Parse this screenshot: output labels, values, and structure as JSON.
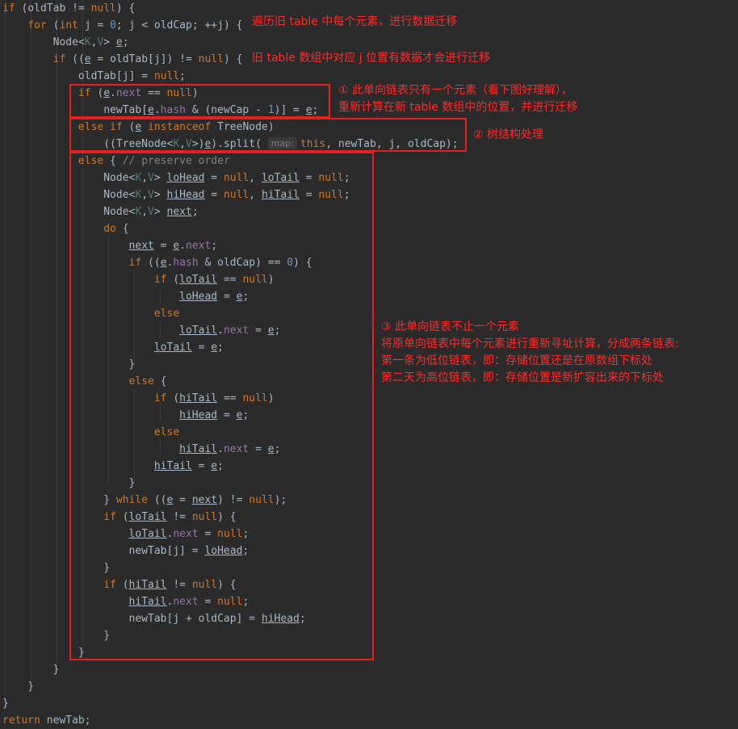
{
  "code_lines": [
    [
      {
        "t": "if",
        "c": "kw"
      },
      {
        "t": " (oldTab != "
      },
      {
        "t": "null",
        "c": "kw"
      },
      {
        "t": ") {"
      }
    ],
    [
      {
        "t": "    "
      },
      {
        "t": "for",
        "c": "kw"
      },
      {
        "t": " ("
      },
      {
        "t": "int",
        "c": "kw"
      },
      {
        "t": " j = "
      },
      {
        "t": "0",
        "c": "num"
      },
      {
        "t": "; j < oldCap; ++j) {"
      }
    ],
    [
      {
        "t": "        Node<"
      },
      {
        "t": "K",
        "c": "gen"
      },
      {
        "t": ","
      },
      {
        "t": "V",
        "c": "gen"
      },
      {
        "t": "> "
      },
      {
        "t": "e",
        "c": "ul"
      },
      {
        "t": ";"
      }
    ],
    [
      {
        "t": "        "
      },
      {
        "t": "if",
        "c": "kw"
      },
      {
        "t": " (("
      },
      {
        "t": "e",
        "c": "ul"
      },
      {
        "t": " = oldTab[j]) != "
      },
      {
        "t": "null",
        "c": "kw"
      },
      {
        "t": ") {"
      }
    ],
    [
      {
        "t": "            oldTab[j] = "
      },
      {
        "t": "null",
        "c": "kw"
      },
      {
        "t": ";"
      }
    ],
    [
      {
        "t": "            "
      },
      {
        "t": "if",
        "c": "kw"
      },
      {
        "t": " ("
      },
      {
        "t": "e",
        "c": "ul"
      },
      {
        "t": "."
      },
      {
        "t": "next",
        "c": "fld"
      },
      {
        "t": " == "
      },
      {
        "t": "null",
        "c": "kw"
      },
      {
        "t": ")"
      }
    ],
    [
      {
        "t": "                newTab["
      },
      {
        "t": "e",
        "c": "ul"
      },
      {
        "t": "."
      },
      {
        "t": "hash",
        "c": "fld"
      },
      {
        "t": " & (newCap - "
      },
      {
        "t": "1",
        "c": "num"
      },
      {
        "t": ")] = "
      },
      {
        "t": "e",
        "c": "ul"
      },
      {
        "t": ";"
      }
    ],
    [
      {
        "t": "            "
      },
      {
        "t": "else if",
        "c": "kw"
      },
      {
        "t": " ("
      },
      {
        "t": "e",
        "c": "ul"
      },
      {
        "t": " "
      },
      {
        "t": "instanceof",
        "c": "kw"
      },
      {
        "t": " TreeNode)"
      }
    ],
    [
      {
        "t": "                ((TreeNode<"
      },
      {
        "t": "K",
        "c": "gen"
      },
      {
        "t": ","
      },
      {
        "t": "V",
        "c": "gen"
      },
      {
        "t": ">)"
      },
      {
        "t": "e",
        "c": "ul"
      },
      {
        "t": ").split( "
      },
      {
        "t": "map:",
        "c": "hint"
      },
      {
        "t": "this",
        "c": "kw"
      },
      {
        "t": ", newTab, j, oldCap);"
      }
    ],
    [
      {
        "t": "            "
      },
      {
        "t": "else",
        "c": "kw"
      },
      {
        "t": " { "
      },
      {
        "t": "// preserve order",
        "c": "cmt"
      }
    ],
    [
      {
        "t": "                Node<"
      },
      {
        "t": "K",
        "c": "gen"
      },
      {
        "t": ","
      },
      {
        "t": "V",
        "c": "gen"
      },
      {
        "t": "> "
      },
      {
        "t": "loHead",
        "c": "ul"
      },
      {
        "t": " = "
      },
      {
        "t": "null",
        "c": "kw"
      },
      {
        "t": ", "
      },
      {
        "t": "loTail",
        "c": "ul"
      },
      {
        "t": " = "
      },
      {
        "t": "null",
        "c": "kw"
      },
      {
        "t": ";"
      }
    ],
    [
      {
        "t": "                Node<"
      },
      {
        "t": "K",
        "c": "gen"
      },
      {
        "t": ","
      },
      {
        "t": "V",
        "c": "gen"
      },
      {
        "t": "> "
      },
      {
        "t": "hiHead",
        "c": "ul"
      },
      {
        "t": " = "
      },
      {
        "t": "null",
        "c": "kw"
      },
      {
        "t": ", "
      },
      {
        "t": "hiTail",
        "c": "ul"
      },
      {
        "t": " = "
      },
      {
        "t": "null",
        "c": "kw"
      },
      {
        "t": ";"
      }
    ],
    [
      {
        "t": "                Node<"
      },
      {
        "t": "K",
        "c": "gen"
      },
      {
        "t": ","
      },
      {
        "t": "V",
        "c": "gen"
      },
      {
        "t": "> "
      },
      {
        "t": "next",
        "c": "ul"
      },
      {
        "t": ";"
      }
    ],
    [
      {
        "t": "                "
      },
      {
        "t": "do",
        "c": "kw"
      },
      {
        "t": " {"
      }
    ],
    [
      {
        "t": "                    "
      },
      {
        "t": "next",
        "c": "ul"
      },
      {
        "t": " = "
      },
      {
        "t": "e",
        "c": "ul"
      },
      {
        "t": "."
      },
      {
        "t": "next",
        "c": "fld"
      },
      {
        "t": ";"
      }
    ],
    [
      {
        "t": "                    "
      },
      {
        "t": "if",
        "c": "kw"
      },
      {
        "t": " (("
      },
      {
        "t": "e",
        "c": "ul"
      },
      {
        "t": "."
      },
      {
        "t": "hash",
        "c": "fld"
      },
      {
        "t": " & oldCap) == "
      },
      {
        "t": "0",
        "c": "num"
      },
      {
        "t": ") {"
      }
    ],
    [
      {
        "t": "                        "
      },
      {
        "t": "if",
        "c": "kw"
      },
      {
        "t": " ("
      },
      {
        "t": "loTail",
        "c": "ul"
      },
      {
        "t": " == "
      },
      {
        "t": "null",
        "c": "kw"
      },
      {
        "t": ")"
      }
    ],
    [
      {
        "t": "                            "
      },
      {
        "t": "loHead",
        "c": "ul"
      },
      {
        "t": " = "
      },
      {
        "t": "e",
        "c": "ul"
      },
      {
        "t": ";"
      }
    ],
    [
      {
        "t": "                        "
      },
      {
        "t": "else",
        "c": "kw"
      }
    ],
    [
      {
        "t": "                            "
      },
      {
        "t": "loTail",
        "c": "ul"
      },
      {
        "t": "."
      },
      {
        "t": "next",
        "c": "fld"
      },
      {
        "t": " = "
      },
      {
        "t": "e",
        "c": "ul"
      },
      {
        "t": ";"
      }
    ],
    [
      {
        "t": "                        "
      },
      {
        "t": "loTail",
        "c": "ul"
      },
      {
        "t": " = "
      },
      {
        "t": "e",
        "c": "ul"
      },
      {
        "t": ";"
      }
    ],
    [
      {
        "t": "                    }"
      }
    ],
    [
      {
        "t": "                    "
      },
      {
        "t": "else",
        "c": "kw"
      },
      {
        "t": " {"
      }
    ],
    [
      {
        "t": "                        "
      },
      {
        "t": "if",
        "c": "kw"
      },
      {
        "t": " ("
      },
      {
        "t": "hiTail",
        "c": "ul"
      },
      {
        "t": " == "
      },
      {
        "t": "null",
        "c": "kw"
      },
      {
        "t": ")"
      }
    ],
    [
      {
        "t": "                            "
      },
      {
        "t": "hiHead",
        "c": "ul"
      },
      {
        "t": " = "
      },
      {
        "t": "e",
        "c": "ul"
      },
      {
        "t": ";"
      }
    ],
    [
      {
        "t": "                        "
      },
      {
        "t": "else",
        "c": "kw"
      }
    ],
    [
      {
        "t": "                            "
      },
      {
        "t": "hiTail",
        "c": "ul"
      },
      {
        "t": "."
      },
      {
        "t": "next",
        "c": "fld"
      },
      {
        "t": " = "
      },
      {
        "t": "e",
        "c": "ul"
      },
      {
        "t": ";"
      }
    ],
    [
      {
        "t": "                        "
      },
      {
        "t": "hiTail",
        "c": "ul"
      },
      {
        "t": " = "
      },
      {
        "t": "e",
        "c": "ul"
      },
      {
        "t": ";"
      }
    ],
    [
      {
        "t": "                    }"
      }
    ],
    [
      {
        "t": "                } "
      },
      {
        "t": "while",
        "c": "kw"
      },
      {
        "t": " (("
      },
      {
        "t": "e",
        "c": "ul"
      },
      {
        "t": " = "
      },
      {
        "t": "next",
        "c": "ul"
      },
      {
        "t": ") != "
      },
      {
        "t": "null",
        "c": "kw"
      },
      {
        "t": ");"
      }
    ],
    [
      {
        "t": "                "
      },
      {
        "t": "if",
        "c": "kw"
      },
      {
        "t": " ("
      },
      {
        "t": "loTail",
        "c": "ul"
      },
      {
        "t": " != "
      },
      {
        "t": "null",
        "c": "kw"
      },
      {
        "t": ") {"
      }
    ],
    [
      {
        "t": "                    "
      },
      {
        "t": "loTail",
        "c": "ul"
      },
      {
        "t": "."
      },
      {
        "t": "next",
        "c": "fld"
      },
      {
        "t": " = "
      },
      {
        "t": "null",
        "c": "kw"
      },
      {
        "t": ";"
      }
    ],
    [
      {
        "t": "                    newTab[j] = "
      },
      {
        "t": "loHead",
        "c": "ul"
      },
      {
        "t": ";"
      }
    ],
    [
      {
        "t": "                }"
      }
    ],
    [
      {
        "t": "                "
      },
      {
        "t": "if",
        "c": "kw"
      },
      {
        "t": " ("
      },
      {
        "t": "hiTail",
        "c": "ul"
      },
      {
        "t": " != "
      },
      {
        "t": "null",
        "c": "kw"
      },
      {
        "t": ") {"
      }
    ],
    [
      {
        "t": "                    "
      },
      {
        "t": "hiTail",
        "c": "ul"
      },
      {
        "t": "."
      },
      {
        "t": "next",
        "c": "fld"
      },
      {
        "t": " = "
      },
      {
        "t": "null",
        "c": "kw"
      },
      {
        "t": ";"
      }
    ],
    [
      {
        "t": "                    newTab[j + oldCap] = "
      },
      {
        "t": "hiHead",
        "c": "ul"
      },
      {
        "t": ";"
      }
    ],
    [
      {
        "t": "                }"
      }
    ],
    [
      {
        "t": "            }"
      }
    ],
    [
      {
        "t": "        }"
      }
    ],
    [
      {
        "t": "    }"
      }
    ],
    [
      {
        "t": "}"
      }
    ],
    [
      {
        "t": "return",
        "c": "kw"
      },
      {
        "t": " newTab;"
      }
    ]
  ],
  "annotations": {
    "loop": "遍历旧 table 中每个元素，进行数据迁移",
    "non_null": "旧 table 数组中对应 j 位置有数据才会进行迁移",
    "single_1": "① 此单向链表只有一个元素（看下图好理解），",
    "single_2": "重新计算在新 table 数组中的位置，并进行迁移",
    "tree": "② 树结构处理",
    "list_1": "③ 此单向链表不止一个元素",
    "list_2": "将原单向链表中每个元素进行重新寻址计算，分成两条链表:",
    "list_3": "第一条为低位链表，即：存储位置还是在原数组下标处",
    "list_4": "第二天为高位链表，即：存储位置是新扩容出来的下标处"
  },
  "colors": {
    "background": "#2b2b2b",
    "default_text": "#a9b7c6",
    "keyword": "#cc7832",
    "number": "#6897bb",
    "field": "#9876aa",
    "generic": "#507874",
    "comment": "#808080",
    "annotation": "#ff2b2b"
  }
}
